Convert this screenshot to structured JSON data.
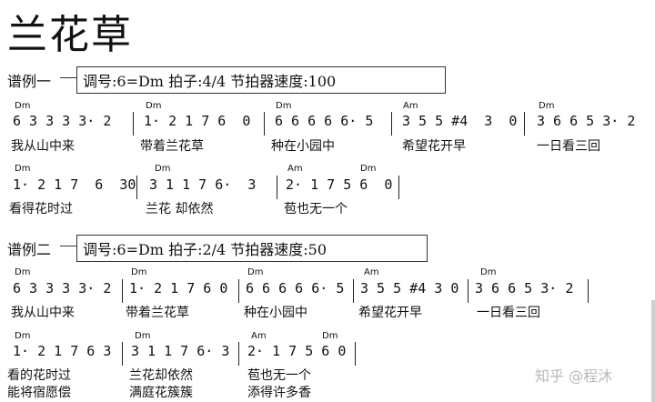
{
  "title": "兰花草",
  "example1": {
    "label": "谱例一",
    "info": "调号:6=Dm  拍子:4/4  节拍器速度:100",
    "line1": {
      "chords": [
        "Dm",
        "Dm",
        "Dm",
        "Am",
        "Dm"
      ],
      "measures": [
        "6 3 3 3 3· 2",
        "1· 2 1 7 6  0",
        "6 6 6 6 6· 5",
        "3 5 5 #4  3  0",
        "3 6 6 5 3· 2"
      ],
      "lyrics": [
        "我从山中来",
        "带着兰花草",
        "种在小园中",
        "希望花开早",
        "一日看三回"
      ]
    },
    "line2": {
      "chords": [
        "Dm",
        "Am",
        "Dm"
      ],
      "measures": [
        "1· 2 1 7  6  30",
        "3 1 1 7 6·  3",
        "2· 1 7 5 6  0"
      ],
      "lyrics": [
        "看得花时过",
        "兰花 却依然",
        "苞也无一个"
      ]
    }
  },
  "example2": {
    "label": "谱例二",
    "info": "调号:6=Dm  拍子:2/4  节拍器速度:50",
    "line1": {
      "chords": [
        "Dm",
        "Dm",
        "Dm",
        "Am",
        "Dm"
      ],
      "measures": [
        "6 3 3 3 3· 2",
        "1· 2 1 7 6 0",
        "6 6 6 6 6· 5",
        "3 5 5 #4 3 0",
        "3 6 6 5 3· 2"
      ],
      "lyrics": [
        "我从山中来",
        "带着兰花草",
        "种在小园中",
        "希望花开早",
        "一日看三回"
      ]
    },
    "line2": {
      "chords": [
        "Am",
        "Dm"
      ],
      "measures": [
        "1· 2 1 7 6 3",
        "3 1 1 7 6· 3",
        "2· 1 7 5 6 0"
      ],
      "lyrics1": [
        "看的花时过",
        "兰花却依然",
        "苞也无一个"
      ],
      "lyrics2": [
        "能将宿愿偿",
        "满庭花簇簇",
        "添得许多香"
      ]
    }
  },
  "watermark": "知乎 @程沐"
}
